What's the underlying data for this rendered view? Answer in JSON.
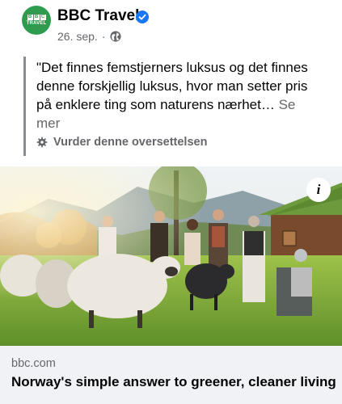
{
  "post": {
    "page_name": "BBC Travel",
    "avatar_text": [
      "B",
      "B",
      "C"
    ],
    "avatar_sub": "TRAVEL",
    "date": "26. sep.",
    "separator": "·",
    "quote": "\"Det finnes femstjerners luksus og det finnes denne forskjellig luksus, hvor man setter pris på enklere ting som naturens nærhet…",
    "see_more": "Se mer",
    "translate_label": "Vurder denne oversettelsen"
  },
  "link": {
    "domain": "bbc.com",
    "title": "Norway's simple answer to greener, cleaner living"
  },
  "photo": {
    "info_label": "i"
  },
  "colors": {
    "brand_green": "#2e9b4f",
    "verified_blue": "#1877f2",
    "secondary_text": "#65676b",
    "card_background": "#f0f2f5"
  },
  "icons": [
    "verified-badge-icon",
    "globe-icon",
    "gear-icon",
    "info-icon"
  ]
}
